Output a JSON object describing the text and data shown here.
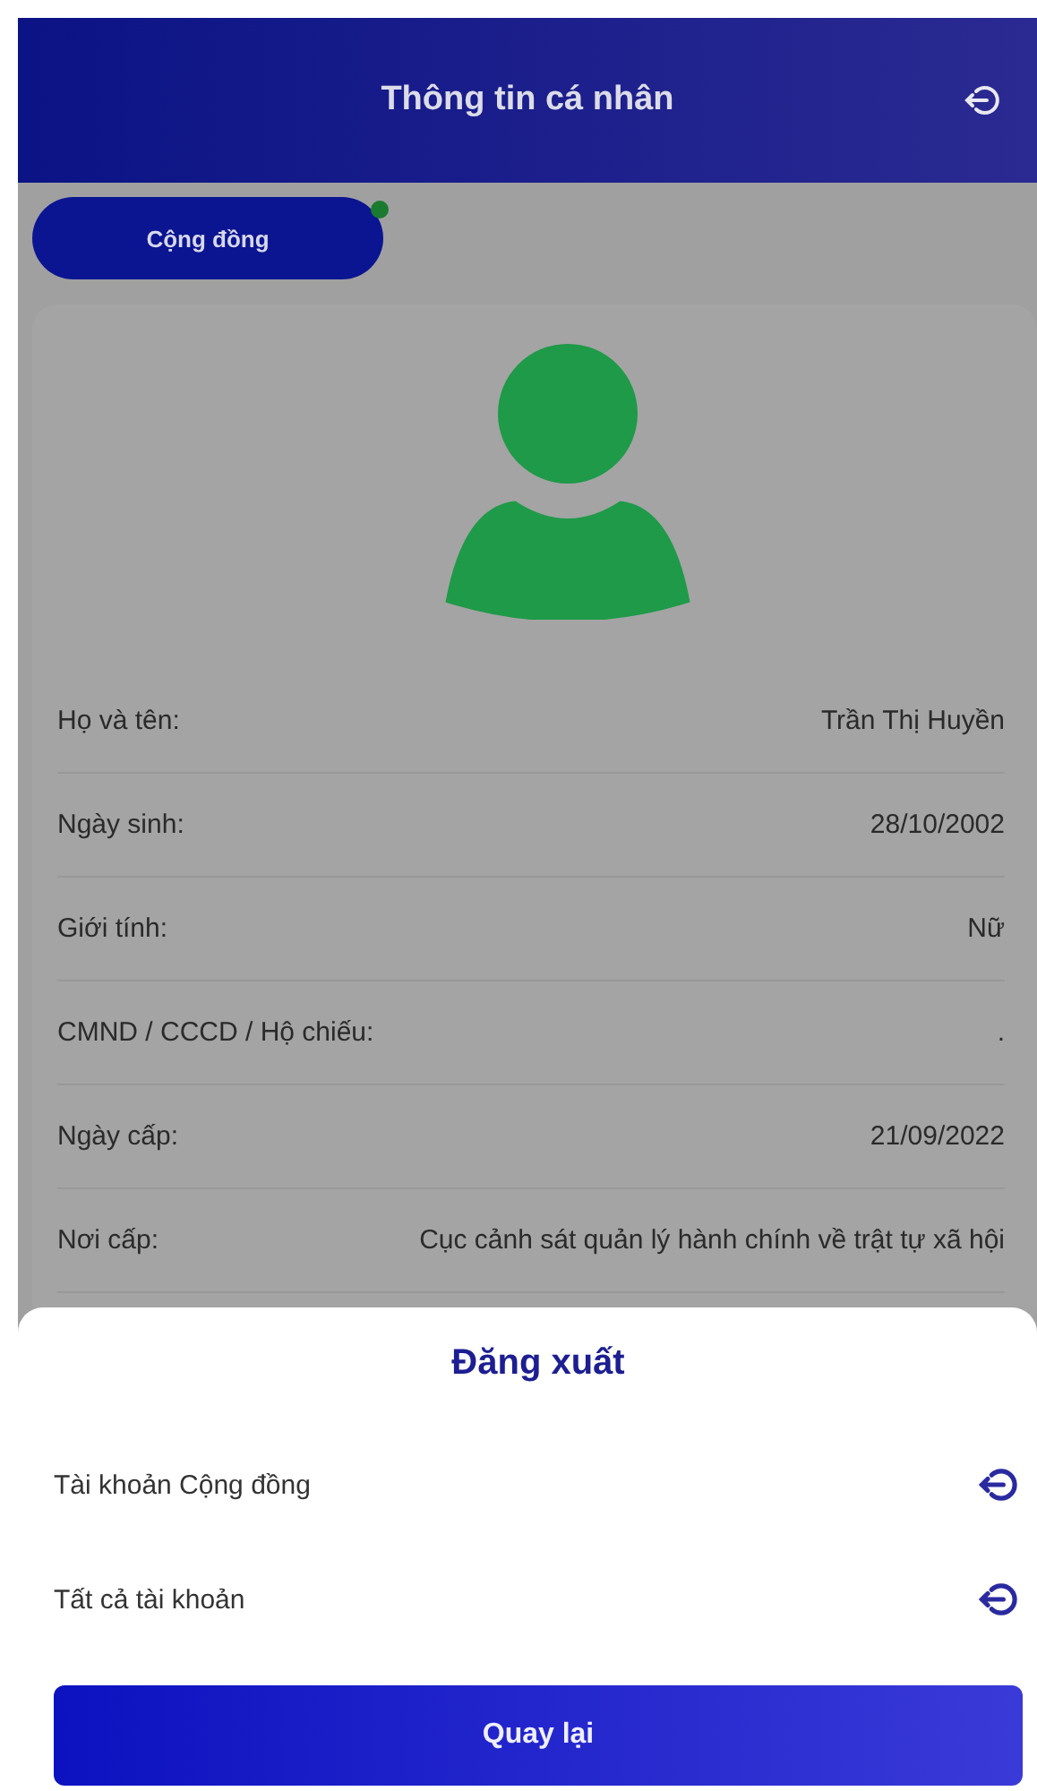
{
  "header": {
    "title": "Thông tin cá nhân"
  },
  "tabs": [
    {
      "label": "Cộng đồng",
      "selected": true,
      "dot": true
    }
  ],
  "profile_fields": [
    {
      "label": "Họ và tên:",
      "value": "Trần Thị Huyền"
    },
    {
      "label": "Ngày sinh:",
      "value": "28/10/2002"
    },
    {
      "label": "Giới tính:",
      "value": "Nữ"
    },
    {
      "label": "CMND / CCCD / Hộ chiếu:",
      "value": "."
    },
    {
      "label": "Ngày cấp:",
      "value": "21/09/2022"
    },
    {
      "label": "Nơi cấp:",
      "value": "Cục cảnh sát quản lý hành chính về trật tự xã hội"
    }
  ],
  "logout_sheet": {
    "title": "Đăng xuất",
    "options": [
      {
        "label": "Tài khoản Cộng đồng"
      },
      {
        "label": "Tất cả tài khoản"
      }
    ],
    "back_button": "Quay lại"
  }
}
